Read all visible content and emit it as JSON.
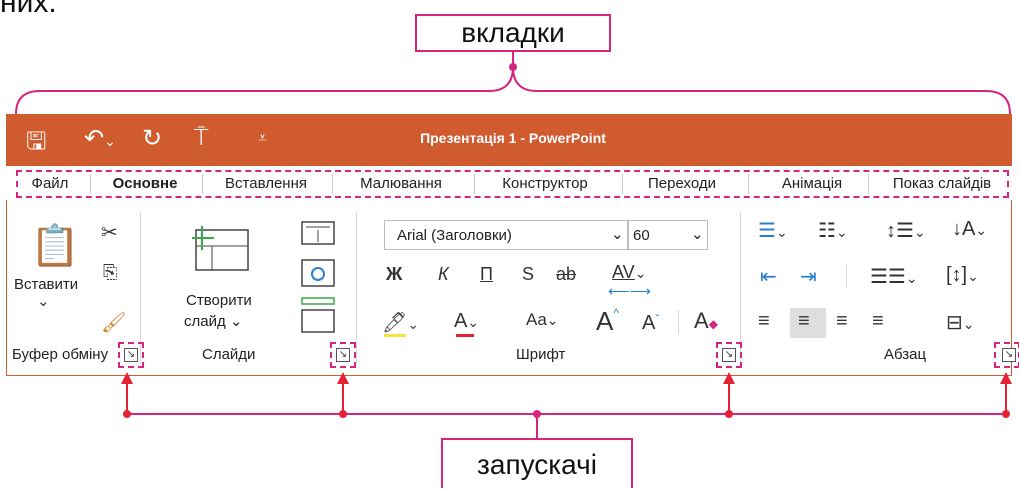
{
  "top_cut_text": "них.",
  "callouts": {
    "tabs": "вкладки",
    "launchers": "запускачі"
  },
  "app_title": "Презентація 1  -  PowerPoint",
  "colors": {
    "accent": "#cf5b2f",
    "annotation": "#d6257f",
    "pointer": "#e52233"
  },
  "tabs": [
    "Файл",
    "Основне",
    "Вставлення",
    "Малювання",
    "Конструктор",
    "Переходи",
    "Анімація",
    "Показ слайдів"
  ],
  "active_tab": "Основне",
  "groups": {
    "clipboard": {
      "label": "Буфер обміну",
      "paste": "Вставити"
    },
    "slides": {
      "label": "Слайди",
      "new_slide_line1": "Створити",
      "new_slide_line2": "слайд"
    },
    "font": {
      "label": "Шрифт",
      "font_name": "Arial (Заголовки)",
      "font_size": "60",
      "bold": "Ж",
      "italic": "К",
      "underline": "П",
      "shadow": "S",
      "strike": "ab",
      "spacing": "AV",
      "case": "Aa",
      "grow": "A",
      "shrink": "A",
      "clear": "A"
    },
    "paragraph": {
      "label": "Абзац"
    }
  },
  "icons": {
    "dropdown": "chevron-down-icon",
    "launcher": "dialog-launcher-icon"
  }
}
